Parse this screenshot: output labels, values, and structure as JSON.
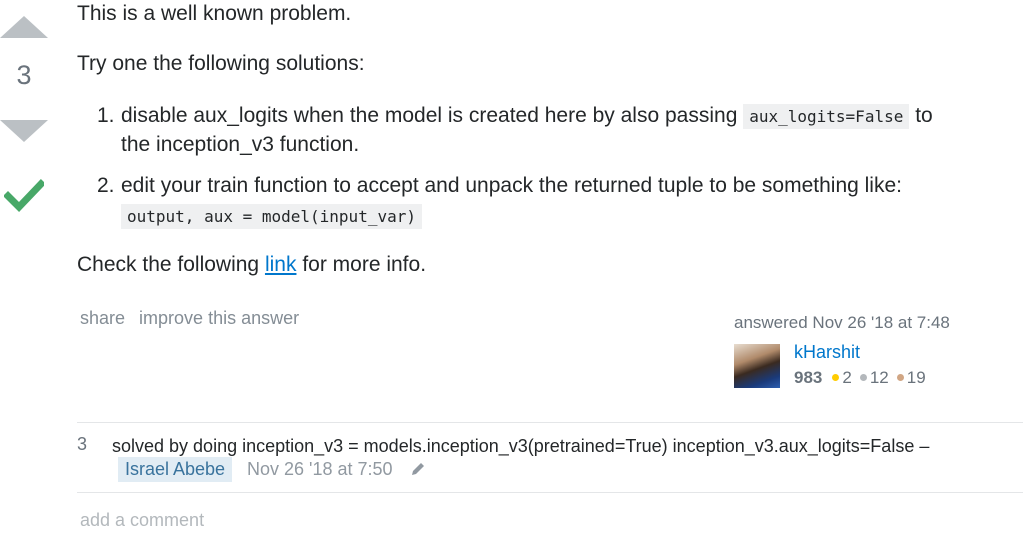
{
  "vote": {
    "count": "3"
  },
  "post": {
    "para1": "This is a well known problem.",
    "para2": "Try one the following solutions:",
    "item1_num": "1.",
    "item1_pre": "disable aux_logits when the model is created here by also passing",
    "item1_code": "aux_logits=False",
    "item1_post": "to",
    "item1_line2": "the inception_v3 function.",
    "item2_num": "2.",
    "item2_text": "edit your train function to accept and unpack the returned tuple to be something like:",
    "item2_code": "output, aux = model(input_var)",
    "para3_pre": "Check the following",
    "para3_link": "link",
    "para3_post": "for more info."
  },
  "menu": {
    "share": "share",
    "improve": "improve this answer"
  },
  "signature": {
    "action": "answered Nov 26 '18 at 7:48",
    "username": "kHarshit",
    "reputation": "983",
    "gold": "2",
    "silver": "12",
    "bronze": "19"
  },
  "comment": {
    "score": "3",
    "text": "solved by doing inception_v3 = models.inception_v3(pretrained=True) inception_v3.aux_logits=False –",
    "user": "Israel Abebe",
    "date": "Nov 26 '18 at 7:50"
  },
  "add_comment": "add a comment",
  "colors": {
    "accepted": "#48a868",
    "link": "#0077cc",
    "vote_arrow": "#bbc0c4"
  },
  "icons": [
    "upvote-icon",
    "downvote-icon",
    "accepted-check-icon",
    "pencil-icon"
  ]
}
